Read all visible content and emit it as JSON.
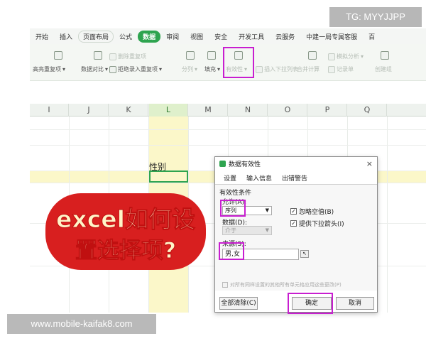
{
  "watermark": {
    "top": "TG: MYYJJPP",
    "bottom": "www.mobile-kaifak8.com"
  },
  "menu": [
    "开始",
    "插入",
    "页面布局",
    "公式",
    "数据",
    "审阅",
    "视图",
    "安全",
    "开发工具",
    "云服务",
    "中建一局专属客服",
    "百"
  ],
  "ribbon": {
    "highlight_dup": "高亮重复项",
    "compare": "数据对比",
    "delete_dup": "删除重复项",
    "reject_dup": "拒绝录入重复项",
    "split": "分列",
    "fill": "填充",
    "validity": "有效性",
    "insert_dropdown": "插入下拉列表",
    "merge_calc": "合并计算",
    "record_list": "记录单",
    "simulate": "模拟分析",
    "create_group": "创建组"
  },
  "columns": [
    "I",
    "J",
    "K",
    "L",
    "M",
    "N",
    "O",
    "P",
    "Q"
  ],
  "cell_header": "性别",
  "dialog": {
    "title": "数据有效性",
    "close": "×",
    "tabs": [
      "设置",
      "输入信息",
      "出错警告"
    ],
    "section": "有效性条件",
    "allow_label": "允许(A):",
    "allow_value": "序列",
    "data_label": "数据(D):",
    "data_value": "介于",
    "ignore_blank": "忽略空值(B)",
    "dropdown_arrow": "提供下拉箭头(I)",
    "source_label": "来源(S):",
    "source_value": "男,女",
    "apply_all": "对所有同样设置的其他所有单元格应用这些更改(P)",
    "clear_all": "全部清除(C)",
    "ok": "确定",
    "cancel": "取消"
  },
  "title_overlay": {
    "line1": "excel如何设",
    "line2": "置选择项?"
  },
  "colors": {
    "accent_green": "#2ea44f",
    "highlight_magenta": "#c81ed0",
    "title_red": "#d81f1f",
    "column_yellow": "#fbf7c9"
  }
}
